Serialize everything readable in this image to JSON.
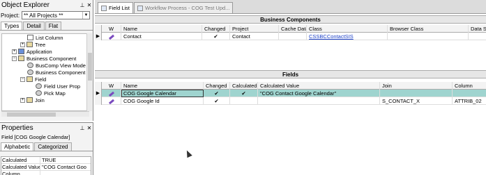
{
  "object_explorer": {
    "title": "Object Explorer",
    "pin_icon": "pin-icon",
    "close_icon": "close-icon",
    "project_label": "Project:",
    "project_value": "** All Projects **",
    "tabs": [
      "Types",
      "Detail",
      "Flat"
    ],
    "active_tab": "Types",
    "tree": [
      {
        "label": "List Column",
        "icon": "page-icon"
      },
      {
        "label": "Tree",
        "icon": "folder-icon"
      },
      {
        "label": "Application",
        "icon": "application-icon"
      },
      {
        "label": "Business Component",
        "icon": "business-component-icon"
      },
      {
        "label": "BusComp View Mode",
        "icon": "gear-icon"
      },
      {
        "label": "Business Component",
        "icon": "gear-icon"
      },
      {
        "label": "Field",
        "icon": "folder-icon"
      },
      {
        "label": "Field User Prop",
        "icon": "gear-icon"
      },
      {
        "label": "Pick Map",
        "icon": "gear-icon"
      },
      {
        "label": "Join",
        "icon": "folder-icon"
      }
    ]
  },
  "properties": {
    "title": "Properties",
    "field_title": "Field [COG Google Calendar]",
    "tabs": [
      "Alphabetic",
      "Categorized"
    ],
    "active_tab": "Alphabetic",
    "rows": [
      {
        "key": "Calculated",
        "value": "TRUE"
      },
      {
        "key": "Calculated Value",
        "value": "\"COG Contact Goo"
      },
      {
        "key": "Column",
        "value": ""
      }
    ]
  },
  "doc_tabs": [
    {
      "label": "Field List",
      "active": true
    },
    {
      "label": "Workflow Process - COG Test Upd...",
      "active": false
    }
  ],
  "business_components": {
    "title": "Business Components",
    "columns": [
      "W",
      "Name",
      "Changed",
      "Project",
      "Cache Data",
      "Class",
      "Browser Class",
      "Data S"
    ],
    "rows": [
      {
        "name": "Contact",
        "changed": "✔",
        "project": "Contact",
        "cache_data": "",
        "class": "CSSBCContactSIS",
        "browser_class": "",
        "data_source": ""
      }
    ]
  },
  "fields": {
    "title": "Fields",
    "columns": [
      "W",
      "Name",
      "Changed",
      "Calculated",
      "Calculated Value",
      "Join",
      "Column"
    ],
    "rows": [
      {
        "name": "COG Google Calendar",
        "changed": "✔",
        "calculated": "✔",
        "calculated_value": "\"COG Contact Google Calendar\"",
        "join": "",
        "column": "",
        "selected": true
      },
      {
        "name": "COG Google Id",
        "changed": "✔",
        "calculated": "",
        "calculated_value": "",
        "join": "S_CONTACT_X",
        "column": "ATTRIB_02",
        "selected": false
      }
    ]
  }
}
